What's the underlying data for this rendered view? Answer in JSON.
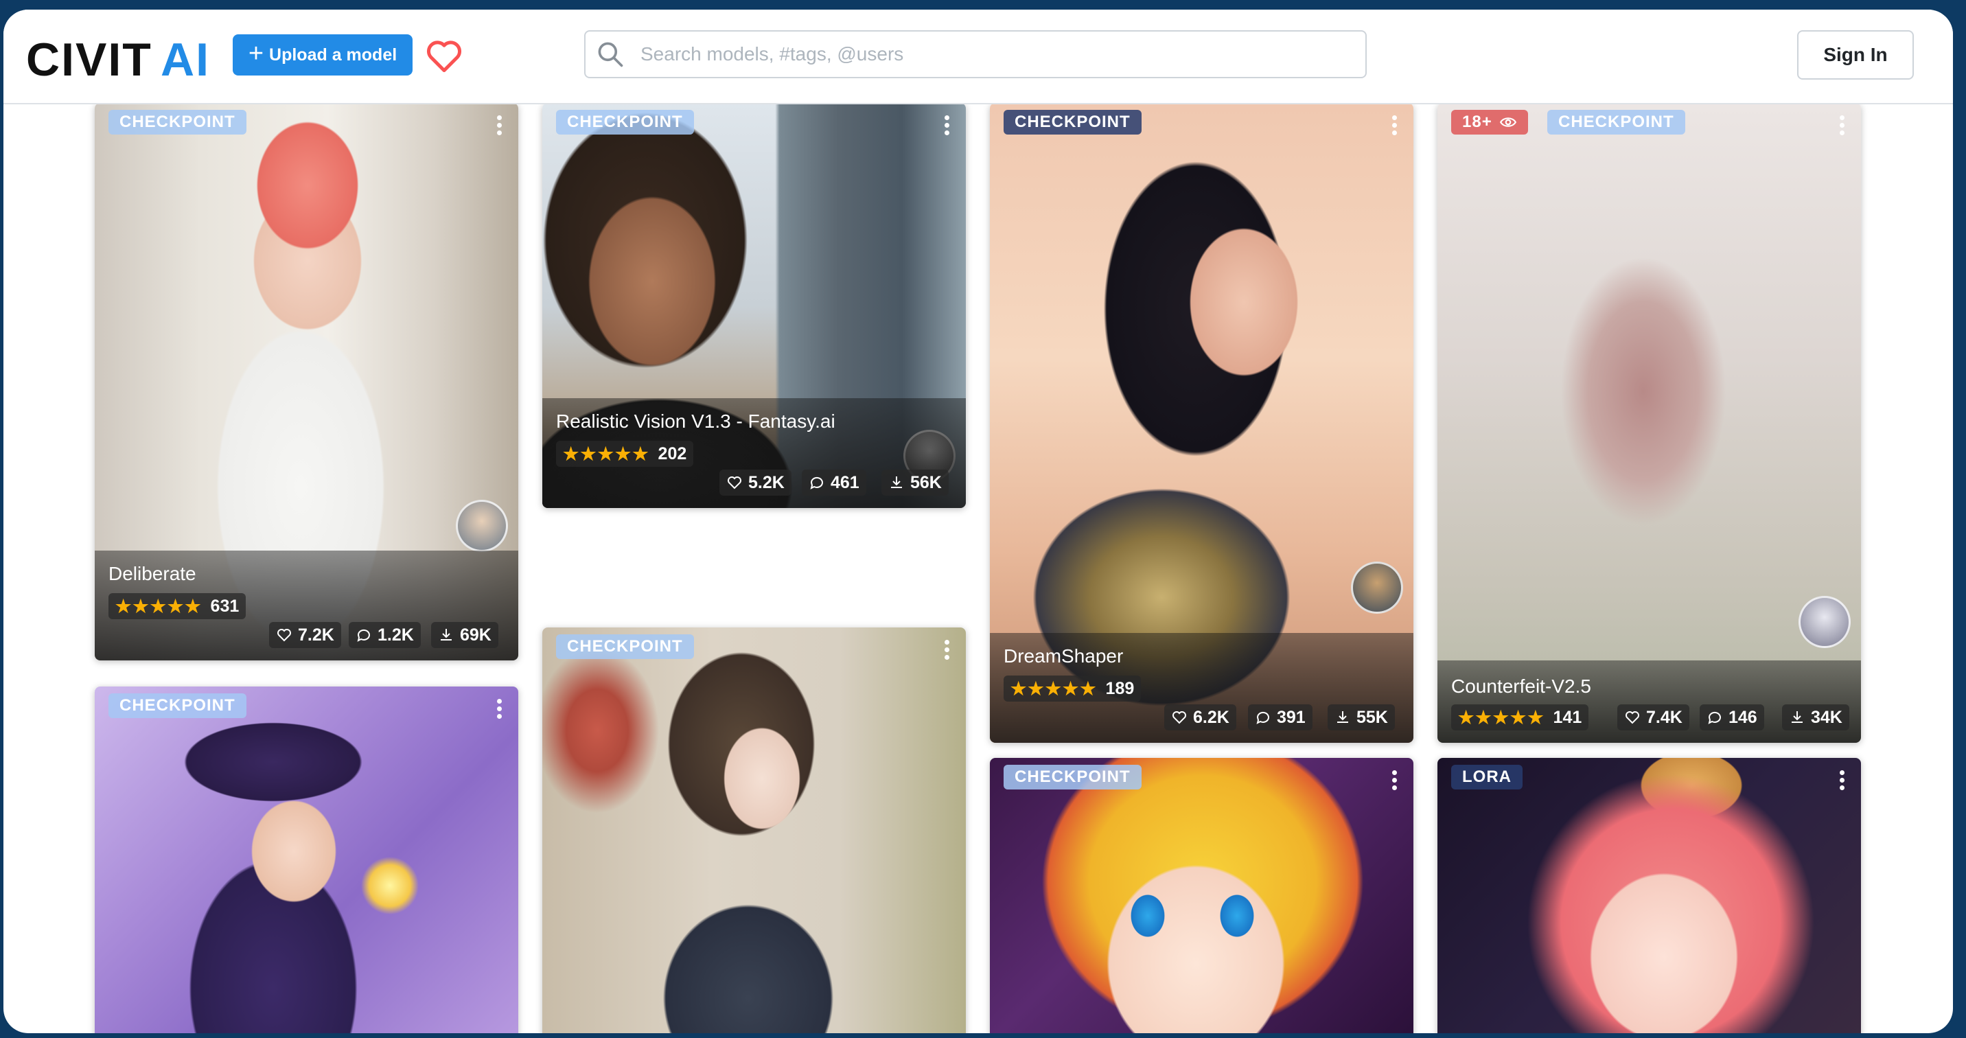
{
  "header": {
    "logo_text": "CIVITAI",
    "upload_label": "Upload a model",
    "search_placeholder": "Search models, #tags, @users",
    "signin_label": "Sign In"
  },
  "colors": {
    "brand_blue": "#228be6",
    "frame": "#0d3a63",
    "star": "#fab005",
    "heart": "#fa5252",
    "nsfw": "#e06c6c"
  },
  "cards": [
    {
      "tag": "CHECKPOINT",
      "title": "Deliberate",
      "rating_count": "631",
      "likes": "7.2K",
      "comments": "1.2K",
      "downloads": "69K"
    },
    {
      "tag": "CHECKPOINT",
      "title": "Realistic Vision V1.3 - Fantasy.ai",
      "rating_count": "202",
      "likes": "5.2K",
      "comments": "461",
      "downloads": "56K"
    },
    {
      "tag": "CHECKPOINT",
      "title": "DreamShaper",
      "rating_count": "189",
      "likes": "6.2K",
      "comments": "391",
      "downloads": "55K"
    },
    {
      "tag": "CHECKPOINT",
      "nsfw_label": "18+",
      "title": "Counterfeit-V2.5",
      "rating_count": "141",
      "likes": "7.4K",
      "comments": "146",
      "downloads": "34K"
    },
    {
      "tag": "CHECKPOINT"
    },
    {
      "tag": "CHECKPOINT"
    },
    {
      "tag": "CHECKPOINT"
    },
    {
      "tag": "LORA"
    }
  ],
  "stars_text": "★★★★★"
}
